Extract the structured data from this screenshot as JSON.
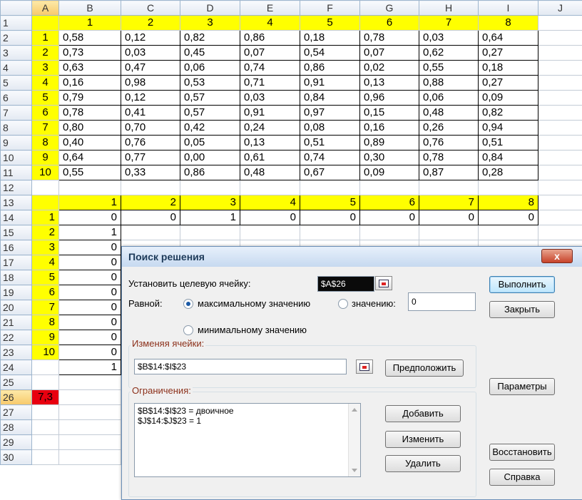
{
  "columns": [
    "",
    "A",
    "B",
    "C",
    "D",
    "E",
    "F",
    "G",
    "H",
    "I",
    "J"
  ],
  "rows": [
    {
      "n": "1",
      "a": "",
      "v": [
        "1",
        "2",
        "3",
        "4",
        "5",
        "6",
        "7",
        "8"
      ],
      "j": ""
    },
    {
      "n": "2",
      "a": "1",
      "v": [
        "0,58",
        "0,12",
        "0,82",
        "0,86",
        "0,18",
        "0,78",
        "0,03",
        "0,64"
      ],
      "j": ""
    },
    {
      "n": "3",
      "a": "2",
      "v": [
        "0,73",
        "0,03",
        "0,45",
        "0,07",
        "0,54",
        "0,07",
        "0,62",
        "0,27"
      ],
      "j": ""
    },
    {
      "n": "4",
      "a": "3",
      "v": [
        "0,63",
        "0,47",
        "0,06",
        "0,74",
        "0,86",
        "0,02",
        "0,55",
        "0,18"
      ],
      "j": ""
    },
    {
      "n": "5",
      "a": "4",
      "v": [
        "0,16",
        "0,98",
        "0,53",
        "0,71",
        "0,91",
        "0,13",
        "0,88",
        "0,27"
      ],
      "j": ""
    },
    {
      "n": "6",
      "a": "5",
      "v": [
        "0,79",
        "0,12",
        "0,57",
        "0,03",
        "0,84",
        "0,96",
        "0,06",
        "0,09"
      ],
      "j": ""
    },
    {
      "n": "7",
      "a": "6",
      "v": [
        "0,78",
        "0,41",
        "0,57",
        "0,91",
        "0,97",
        "0,15",
        "0,48",
        "0,82"
      ],
      "j": ""
    },
    {
      "n": "8",
      "a": "7",
      "v": [
        "0,80",
        "0,70",
        "0,42",
        "0,24",
        "0,08",
        "0,16",
        "0,26",
        "0,94"
      ],
      "j": ""
    },
    {
      "n": "9",
      "a": "8",
      "v": [
        "0,40",
        "0,76",
        "0,05",
        "0,13",
        "0,51",
        "0,89",
        "0,76",
        "0,51"
      ],
      "j": ""
    },
    {
      "n": "10",
      "a": "9",
      "v": [
        "0,64",
        "0,77",
        "0,00",
        "0,61",
        "0,74",
        "0,30",
        "0,78",
        "0,84"
      ],
      "j": ""
    },
    {
      "n": "11",
      "a": "10",
      "v": [
        "0,55",
        "0,33",
        "0,86",
        "0,48",
        "0,67",
        "0,09",
        "0,87",
        "0,28"
      ],
      "j": ""
    },
    {
      "n": "12",
      "a": "",
      "v": [
        "",
        "",
        "",
        "",
        "",
        "",
        "",
        ""
      ],
      "j": ""
    },
    {
      "n": "13",
      "a": "",
      "v": [
        "1",
        "2",
        "3",
        "4",
        "5",
        "6",
        "7",
        "8"
      ],
      "j": ""
    },
    {
      "n": "14",
      "a": "1",
      "v": [
        "0",
        "0",
        "1",
        "0",
        "0",
        "0",
        "0",
        "0"
      ],
      "j": ""
    },
    {
      "n": "15",
      "a": "2",
      "v": [
        "1",
        "",
        "",
        "",
        "",
        "",
        "",
        ""
      ],
      "j": ""
    },
    {
      "n": "16",
      "a": "3",
      "v": [
        "0",
        "",
        "",
        "",
        "",
        "",
        "",
        ""
      ],
      "j": ""
    },
    {
      "n": "17",
      "a": "4",
      "v": [
        "0",
        "",
        "",
        "",
        "",
        "",
        "",
        ""
      ],
      "j": ""
    },
    {
      "n": "18",
      "a": "5",
      "v": [
        "0",
        "",
        "",
        "",
        "",
        "",
        "",
        ""
      ],
      "j": ""
    },
    {
      "n": "19",
      "a": "6",
      "v": [
        "0",
        "",
        "",
        "",
        "",
        "",
        "",
        ""
      ],
      "j": ""
    },
    {
      "n": "20",
      "a": "7",
      "v": [
        "0",
        "",
        "",
        "",
        "",
        "",
        "",
        ""
      ],
      "j": ""
    },
    {
      "n": "21",
      "a": "8",
      "v": [
        "0",
        "",
        "",
        "",
        "",
        "",
        "",
        ""
      ],
      "j": ""
    },
    {
      "n": "22",
      "a": "9",
      "v": [
        "0",
        "",
        "",
        "",
        "",
        "",
        "",
        ""
      ],
      "j": ""
    },
    {
      "n": "23",
      "a": "10",
      "v": [
        "0",
        "",
        "",
        "",
        "",
        "",
        "",
        ""
      ],
      "j": ""
    },
    {
      "n": "24",
      "a": "",
      "v": [
        "1",
        "",
        "",
        "",
        "",
        "",
        "",
        ""
      ],
      "j": ""
    },
    {
      "n": "25",
      "a": "",
      "v": [
        "",
        "",
        "",
        "",
        "",
        "",
        "",
        ""
      ],
      "j": ""
    },
    {
      "n": "26",
      "a": "7,3",
      "v": [
        "",
        "",
        "",
        "",
        "",
        "",
        "",
        ""
      ],
      "j": ""
    },
    {
      "n": "27",
      "a": "",
      "v": [
        "",
        "",
        "",
        "",
        "",
        "",
        "",
        ""
      ],
      "j": ""
    },
    {
      "n": "28",
      "a": "",
      "v": [
        "",
        "",
        "",
        "",
        "",
        "",
        "",
        ""
      ],
      "j": ""
    },
    {
      "n": "29",
      "a": "",
      "v": [
        "",
        "",
        "",
        "",
        "",
        "",
        "",
        ""
      ],
      "j": ""
    },
    {
      "n": "30",
      "a": "",
      "v": [
        "",
        "",
        "",
        "",
        "",
        "",
        "",
        ""
      ],
      "j": ""
    }
  ],
  "dialog": {
    "title": "Поиск решения",
    "close": "x",
    "target_label": "Установить целевую ячейку:",
    "target_value": "$A$26",
    "equal_label": "Равной:",
    "opt_max": "максимальному значению",
    "opt_value": "значению:",
    "value_field": "0",
    "opt_min": "минимальному значению",
    "changing_label": "Изменяя ячейки:",
    "changing_value": "$B$14:$I$23",
    "guess_button": "Предположить",
    "constraints_label": "Ограничения:",
    "constraints": [
      "$B$14:$I$23 = двоичное",
      "$J$14:$J$23 = 1"
    ],
    "add_button": "Добавить",
    "change_button": "Изменить",
    "delete_button": "Удалить",
    "run_button": "Выполнить",
    "close_button": "Закрыть",
    "params_button": "Параметры",
    "reset_button": "Восстановить",
    "help_button": "Справка"
  },
  "colors": {
    "highlight": "#ffff00",
    "objective_cell": "#e8000f",
    "dialog_bg": "#f0f0f0"
  }
}
